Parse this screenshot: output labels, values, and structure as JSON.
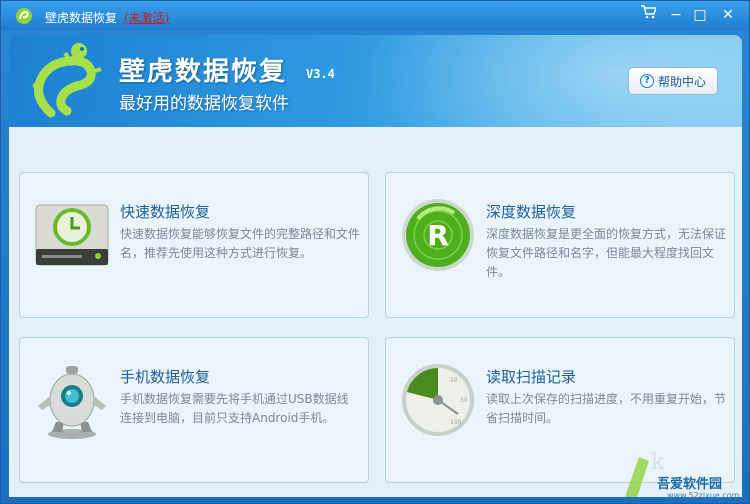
{
  "window": {
    "title": "壁虎数据恢复",
    "status": "(未激活)",
    "controls": {
      "cart": "cart-icon",
      "minimize": "minimize-icon",
      "maximize": "maximize-icon",
      "close": "close-icon"
    }
  },
  "banner": {
    "app_name": "壁虎数据恢复",
    "version": "V3.4",
    "tagline": "最好用的数据恢复软件",
    "help_label": "帮助中心"
  },
  "cards": [
    {
      "title": "快速数据恢复",
      "desc": "快速数据恢复能够恢复文件的完整路径和文件名，推荐先使用这种方式进行恢复。",
      "icon": "clock-drive-icon"
    },
    {
      "title": "深度数据恢复",
      "desc": "深度数据恢复是更全面的恢复方式，无法保证恢复文件路径和名字，但能最大程度找回文件。",
      "icon": "radar-r-icon"
    },
    {
      "title": "手机数据恢复",
      "desc": "手机数据恢复需要先将手机通过USB数据线连接到电脑，目前只支持Android手机。",
      "icon": "robot-icon"
    },
    {
      "title": "读取扫描记录",
      "desc": "读取上次保存的扫描进度，不用重复开始，节省扫描时间。",
      "icon": "gauge-icon"
    }
  ],
  "watermark": {
    "text": "吾爱软件园",
    "url": "www.52zixue.com"
  },
  "colors": {
    "titlebar": "#2a8ad8",
    "accent": "#1f5f9a",
    "card_bg": "#eaf4fa",
    "status_red": "#d01a1a"
  }
}
